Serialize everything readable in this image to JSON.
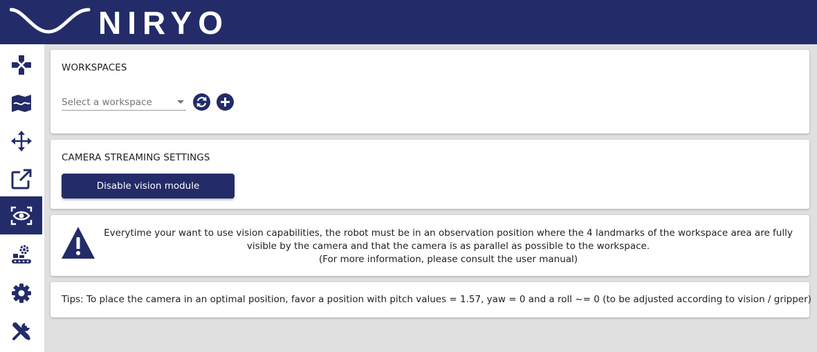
{
  "app": {
    "brand": "NIRYO",
    "brand_color": "#232c68"
  },
  "sidebar": {
    "items": [
      {
        "icon": "gamepad-icon",
        "active": false
      },
      {
        "icon": "map-icon",
        "active": false
      },
      {
        "icon": "move-arrows-icon",
        "active": false
      },
      {
        "icon": "external-link-icon",
        "active": false
      },
      {
        "icon": "eye-scan-icon",
        "active": true
      },
      {
        "icon": "conveyor-gear-icon",
        "active": false
      },
      {
        "icon": "gear-icon",
        "active": false
      },
      {
        "icon": "tools-icon",
        "active": false
      }
    ]
  },
  "workspaces": {
    "title": "WORKSPACES",
    "select_placeholder": "Select a workspace",
    "refresh_icon": "refresh-icon",
    "add_icon": "add-circle-icon"
  },
  "camera": {
    "title": "CAMERA STREAMING SETTINGS",
    "button_label": "Disable vision module"
  },
  "warning": {
    "icon": "warning-triangle-icon",
    "line1": "Everytime your want to use vision capabilities, the robot must be in an observation position where the 4 landmarks of the workspace area are fully visible by the camera and that the camera is as parallel as possible to the workspace.",
    "line2": "(For more information, please consult the user manual)"
  },
  "tips": {
    "text": "Tips: To place the camera in an optimal position, favor a position with pitch values = 1.57, yaw = 0 and a roll ~= 0 (to be adjusted according to vision / gripper)"
  }
}
